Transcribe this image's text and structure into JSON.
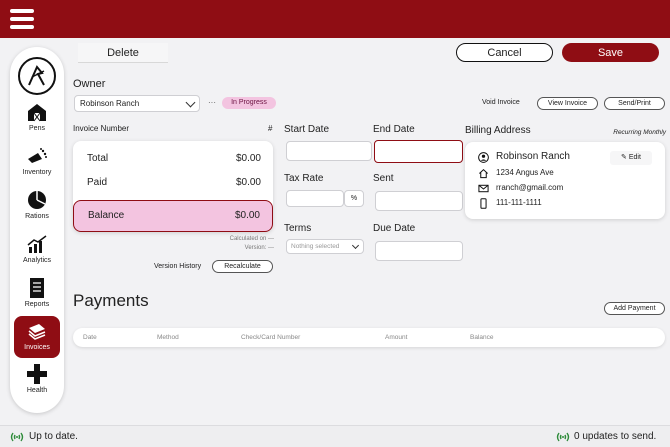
{
  "header": {
    "menu_icon": "hamburger-menu-icon"
  },
  "sidebar": {
    "logo_icon": "farm-logo-icon",
    "items": [
      {
        "label": "Pens",
        "icon": "barn-icon"
      },
      {
        "label": "Inventory",
        "icon": "feed-scoop-icon"
      },
      {
        "label": "Rations",
        "icon": "pie-chart-icon"
      },
      {
        "label": "Analytics",
        "icon": "bar-chart-icon"
      },
      {
        "label": "Reports",
        "icon": "document-icon"
      },
      {
        "label": "Invoices",
        "icon": "cash-stack-icon",
        "active": true
      },
      {
        "label": "Health",
        "icon": "plus-cross-icon"
      }
    ]
  },
  "toolbar": {
    "delete_label": "Delete",
    "cancel_label": "Cancel",
    "save_label": "Save"
  },
  "owner": {
    "label": "Owner",
    "selected": "Robinson Ranch",
    "more": "···",
    "status_badge": "In Progress"
  },
  "actions": {
    "void_label": "Void Invoice",
    "view_label": "View Invoice",
    "send_label": "Send/Print"
  },
  "invoice": {
    "number_label": "Invoice Number",
    "hash_label": "#",
    "total_label": "Total",
    "total_value": "$0.00",
    "paid_label": "Paid",
    "paid_value": "$0.00",
    "balance_label": "Balance",
    "balance_value": "$0.00",
    "calculated_on": "Calculated on ---",
    "version": "Version: ---",
    "version_history_label": "Version History",
    "recalculate_label": "Recalculate"
  },
  "fields": {
    "start_date_label": "Start Date",
    "end_date_label": "End Date",
    "tax_rate_label": "Tax Rate",
    "percent_label": "%",
    "sent_label": "Sent",
    "terms_label": "Terms",
    "terms_placeholder": "Nothing selected",
    "due_date_label": "Due Date"
  },
  "billing": {
    "label": "Billing Address",
    "recurring_label": "Recurring Monthly",
    "name": "Robinson Ranch",
    "edit_label": "Edit",
    "address": "1234 Angus Ave",
    "email": "rranch@gmail.com",
    "phone": "111-111-1111"
  },
  "payments": {
    "title": "Payments",
    "add_label": "Add Payment",
    "columns": [
      "Date",
      "Method",
      "Check/Card Number",
      "Amount",
      "Balance"
    ]
  },
  "status": {
    "left_text": "Up to date.",
    "right_text": "0 updates to send.",
    "status_color": "#2e8b3a"
  },
  "colors": {
    "brand": "#8f0d14",
    "badge": "#f3c4e0"
  }
}
